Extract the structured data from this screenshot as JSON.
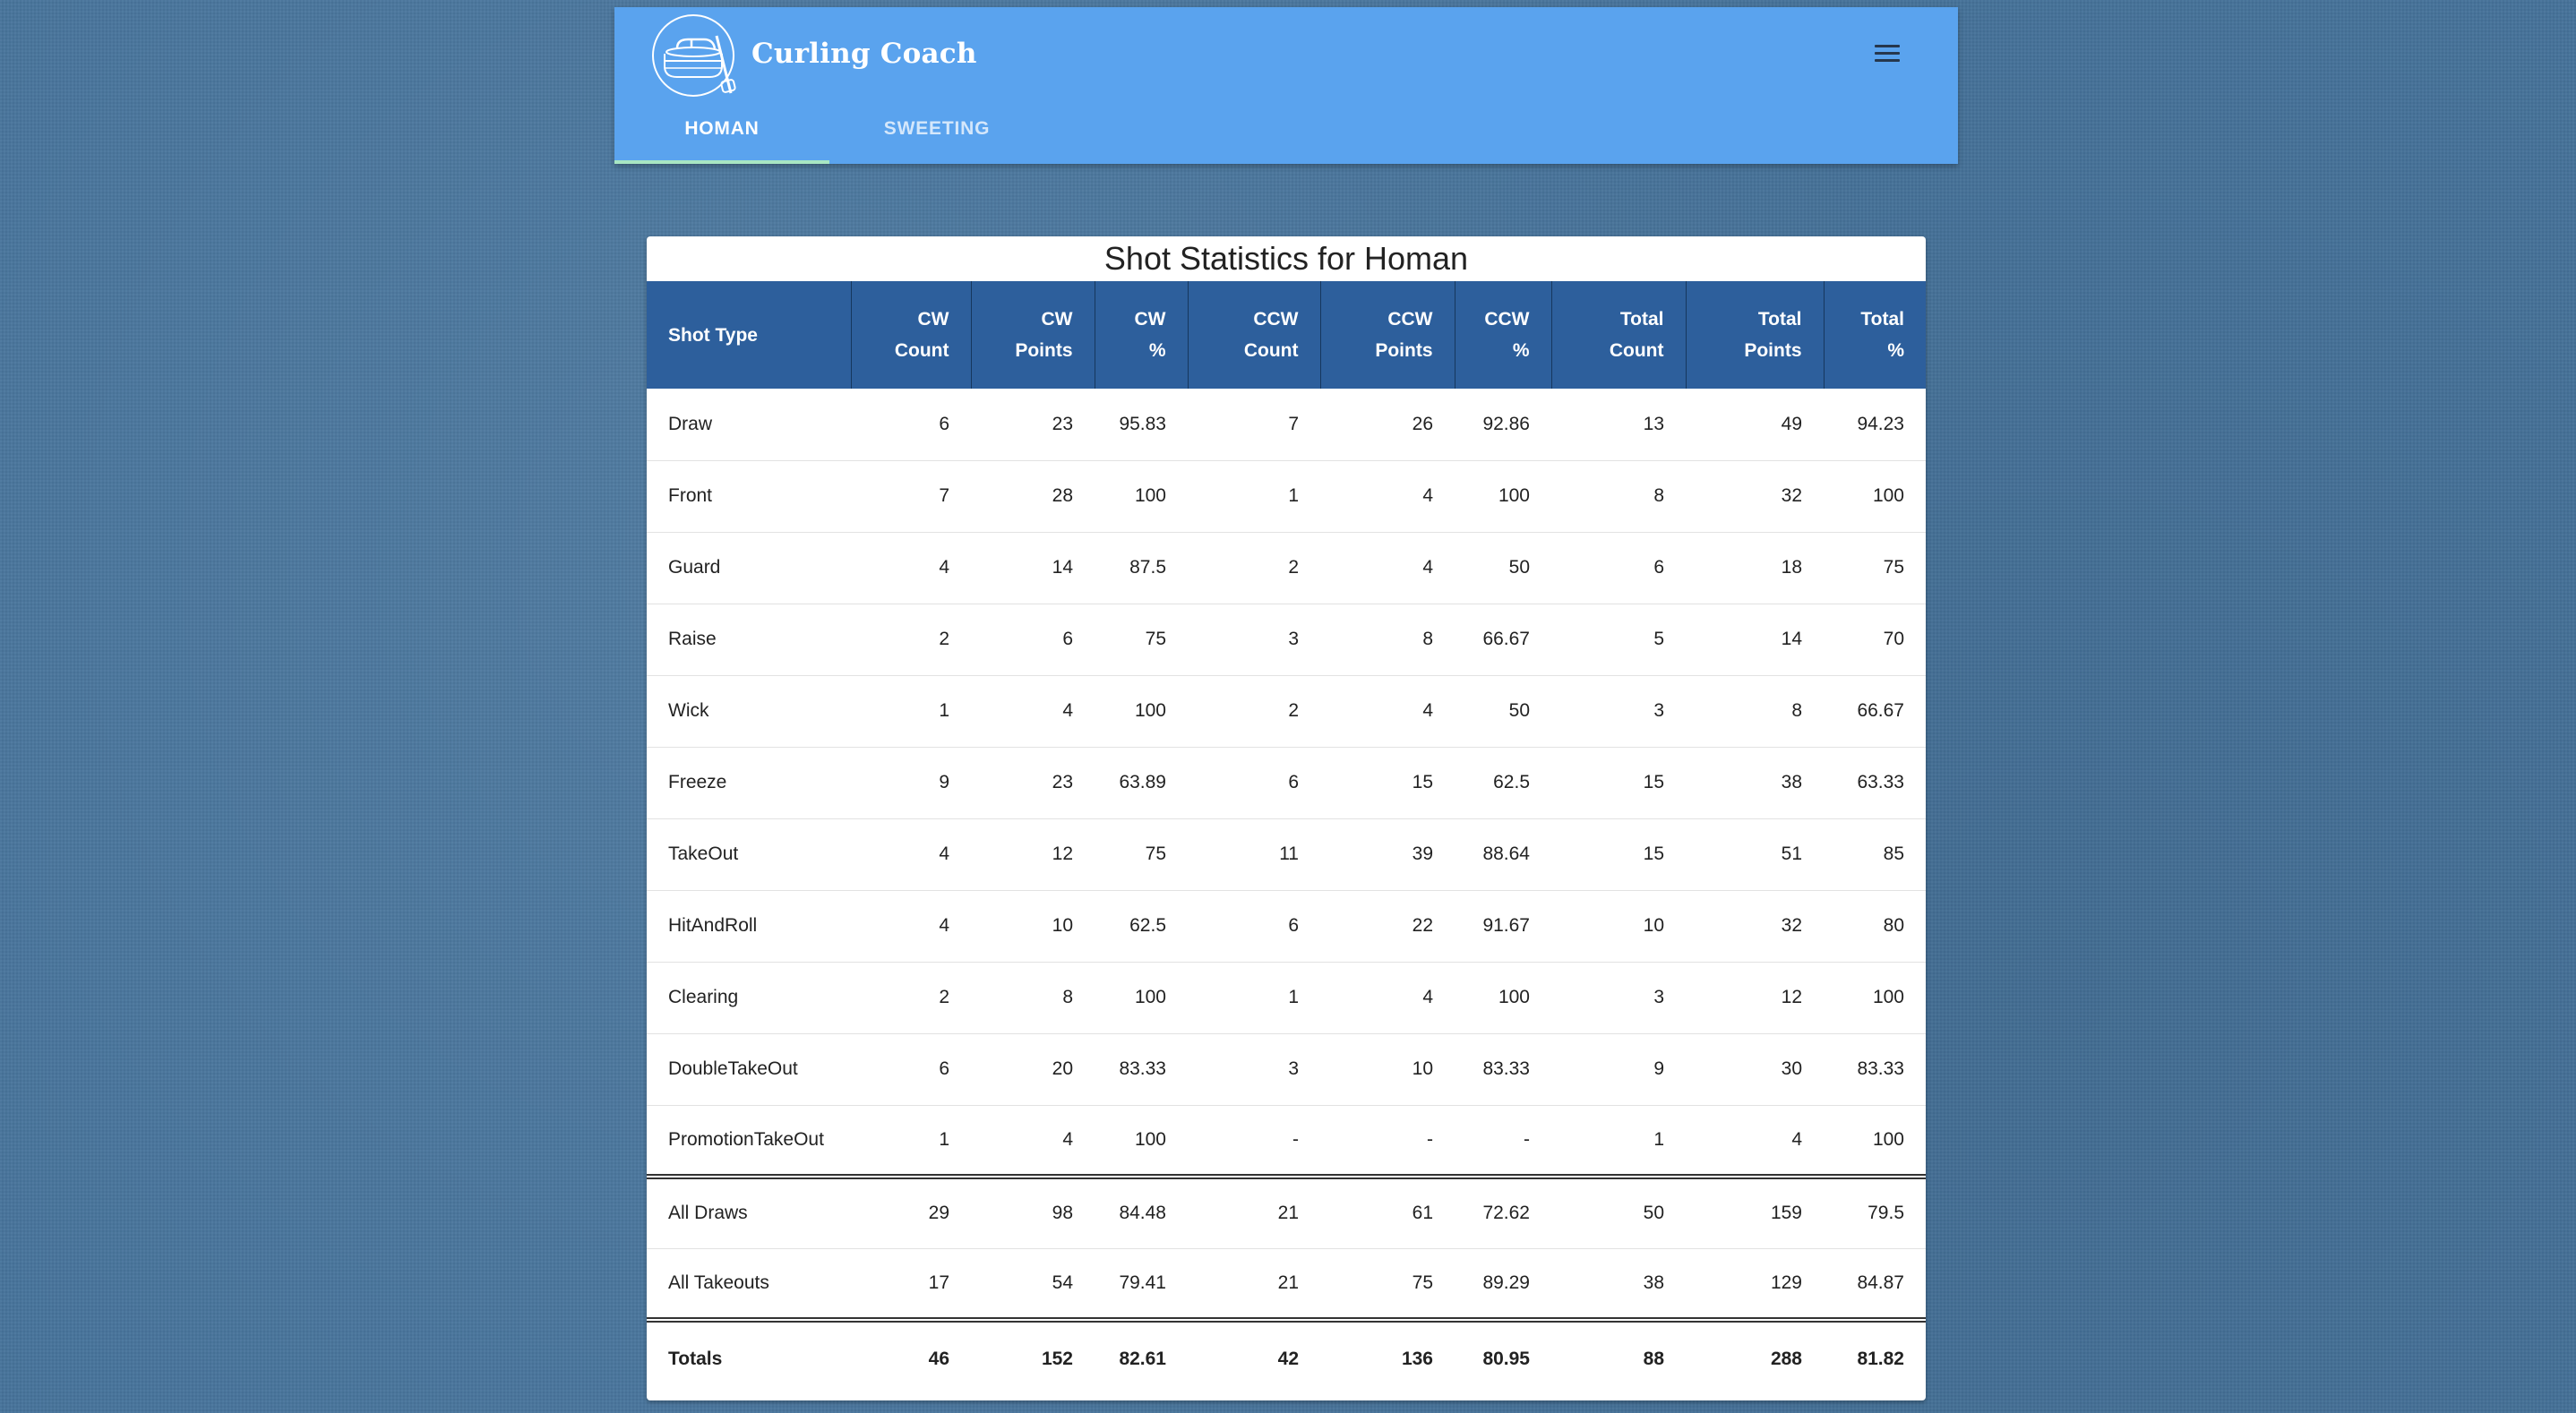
{
  "app": {
    "title": "Curling Coach",
    "logo_icon": "curling-stone-icon",
    "menu_icon": "hamburger-menu-icon"
  },
  "tabs": [
    {
      "label": "HOMAN",
      "active": true
    },
    {
      "label": "SWEETING",
      "active": false
    }
  ],
  "colors": {
    "appbar": "#5aa3ee",
    "table_header": "#2d5f9c",
    "tab_indicator": "#a8e6c3",
    "page_background": "#46739b"
  },
  "table": {
    "title": "Shot Statistics for Homan",
    "headers": [
      [
        "Shot Type"
      ],
      [
        "CW",
        "Count"
      ],
      [
        "CW",
        "Points"
      ],
      [
        "CW %"
      ],
      [
        "CCW",
        "Count"
      ],
      [
        "CCW",
        "Points"
      ],
      [
        "CCW",
        "%"
      ],
      [
        "Total",
        "Count"
      ],
      [
        "Total",
        "Points"
      ],
      [
        "Total",
        "%"
      ]
    ],
    "rows": [
      [
        "Draw",
        "6",
        "23",
        "95.83",
        "7",
        "26",
        "92.86",
        "13",
        "49",
        "94.23"
      ],
      [
        "Front",
        "7",
        "28",
        "100",
        "1",
        "4",
        "100",
        "8",
        "32",
        "100"
      ],
      [
        "Guard",
        "4",
        "14",
        "87.5",
        "2",
        "4",
        "50",
        "6",
        "18",
        "75"
      ],
      [
        "Raise",
        "2",
        "6",
        "75",
        "3",
        "8",
        "66.67",
        "5",
        "14",
        "70"
      ],
      [
        "Wick",
        "1",
        "4",
        "100",
        "2",
        "4",
        "50",
        "3",
        "8",
        "66.67"
      ],
      [
        "Freeze",
        "9",
        "23",
        "63.89",
        "6",
        "15",
        "62.5",
        "15",
        "38",
        "63.33"
      ],
      [
        "TakeOut",
        "4",
        "12",
        "75",
        "11",
        "39",
        "88.64",
        "15",
        "51",
        "85"
      ],
      [
        "HitAndRoll",
        "4",
        "10",
        "62.5",
        "6",
        "22",
        "91.67",
        "10",
        "32",
        "80"
      ],
      [
        "Clearing",
        "2",
        "8",
        "100",
        "1",
        "4",
        "100",
        "3",
        "12",
        "100"
      ],
      [
        "DoubleTakeOut",
        "6",
        "20",
        "83.33",
        "3",
        "10",
        "83.33",
        "9",
        "30",
        "83.33"
      ],
      [
        "PromotionTakeOut",
        "1",
        "4",
        "100",
        "-",
        "-",
        "-",
        "1",
        "4",
        "100"
      ]
    ],
    "summary_rows": [
      [
        "All Draws",
        "29",
        "98",
        "84.48",
        "21",
        "61",
        "72.62",
        "50",
        "159",
        "79.5"
      ],
      [
        "All Takeouts",
        "17",
        "54",
        "79.41",
        "21",
        "75",
        "89.29",
        "38",
        "129",
        "84.87"
      ]
    ],
    "totals": [
      "Totals",
      "46",
      "152",
      "82.61",
      "42",
      "136",
      "80.95",
      "88",
      "288",
      "81.82"
    ]
  }
}
